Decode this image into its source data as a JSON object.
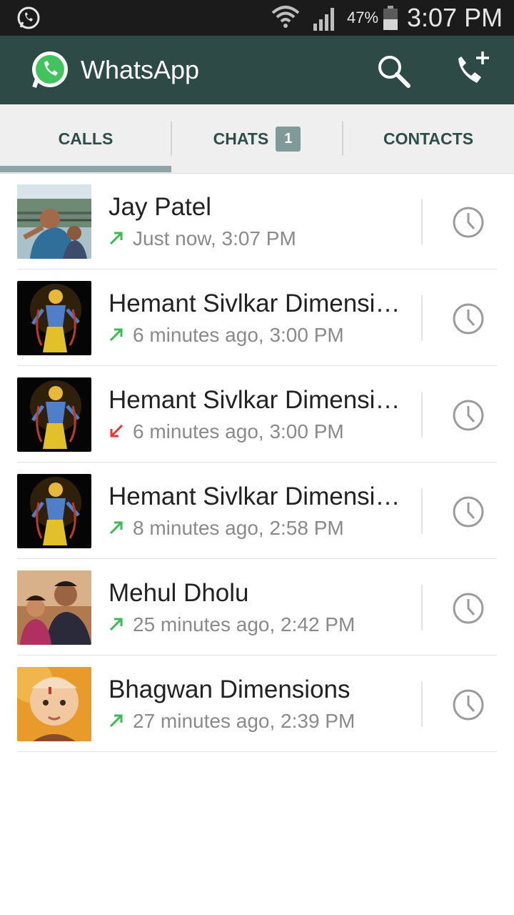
{
  "status_bar": {
    "battery": "47%",
    "time": "3:07 PM"
  },
  "app_bar": {
    "title": "WhatsApp"
  },
  "tabs": [
    {
      "label": "CALLS",
      "active": true
    },
    {
      "label": "CHATS",
      "badge": "1"
    },
    {
      "label": "CONTACTS"
    }
  ],
  "calls": [
    {
      "name": "Jay Patel",
      "direction": "outgoing",
      "time": "Just now, 3:07 PM"
    },
    {
      "name": "Hemant Sivlkar Dimensions",
      "direction": "outgoing",
      "time": "6 minutes ago, 3:00 PM"
    },
    {
      "name": "Hemant Sivlkar Dimensions",
      "direction": "missed",
      "time": "6 minutes ago, 3:00 PM"
    },
    {
      "name": "Hemant Sivlkar Dimensions",
      "direction": "outgoing",
      "time": "8 minutes ago, 2:58 PM"
    },
    {
      "name": "Mehul Dholu",
      "direction": "outgoing",
      "time": "25 minutes ago, 2:42 PM"
    },
    {
      "name": "Bhagwan Dimensions",
      "direction": "outgoing",
      "time": "27 minutes ago, 2:39 PM"
    }
  ],
  "colors": {
    "appbar": "#2e4a47",
    "outgoing": "#3cba54",
    "missed": "#e53935",
    "accent": "#2c4f4a"
  }
}
